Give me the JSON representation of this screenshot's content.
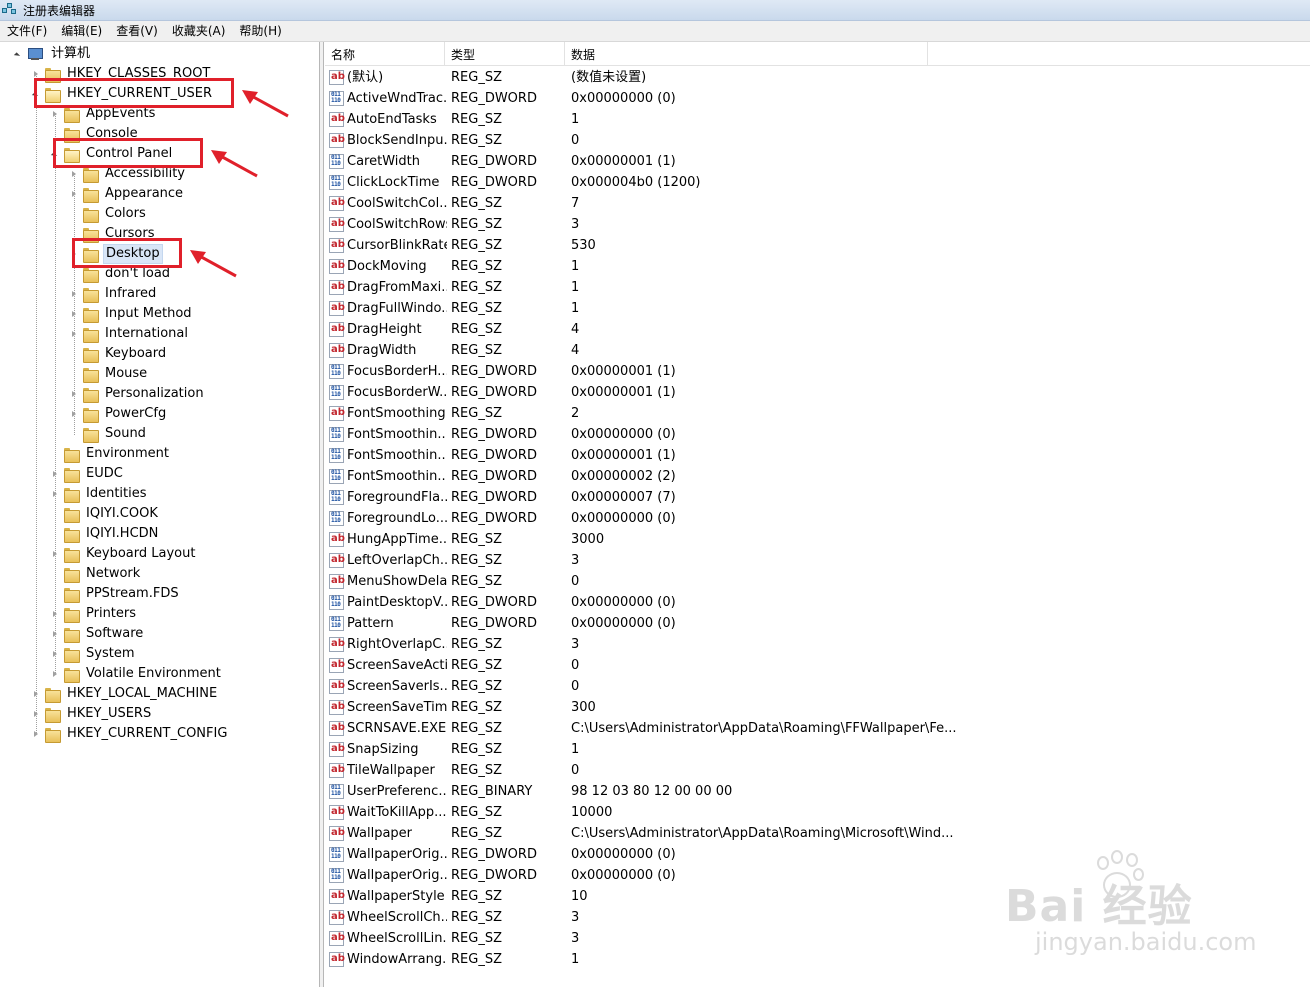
{
  "window": {
    "title": "注册表编辑器"
  },
  "menu": [
    "文件(F)",
    "编辑(E)",
    "查看(V)",
    "收藏夹(A)",
    "帮助(H)"
  ],
  "tree": [
    {
      "label": "计算机",
      "level": 0,
      "exp": "open",
      "icon": "computer-icon"
    },
    {
      "label": "HKEY_CLASSES_ROOT",
      "level": 1,
      "exp": "closed"
    },
    {
      "label": "HKEY_CURRENT_USER",
      "level": 1,
      "exp": "open",
      "highlight": true
    },
    {
      "label": "AppEvents",
      "level": 2,
      "exp": "closed"
    },
    {
      "label": "Console",
      "level": 2,
      "exp": "none"
    },
    {
      "label": "Control Panel",
      "level": 2,
      "exp": "open",
      "highlight": true
    },
    {
      "label": "Accessibility",
      "level": 3,
      "exp": "closed"
    },
    {
      "label": "Appearance",
      "level": 3,
      "exp": "closed"
    },
    {
      "label": "Colors",
      "level": 3,
      "exp": "none"
    },
    {
      "label": "Cursors",
      "level": 3,
      "exp": "none"
    },
    {
      "label": "Desktop",
      "level": 3,
      "exp": "closed",
      "highlight": true,
      "selected": true
    },
    {
      "label": "don't load",
      "level": 3,
      "exp": "none"
    },
    {
      "label": "Infrared",
      "level": 3,
      "exp": "closed"
    },
    {
      "label": "Input Method",
      "level": 3,
      "exp": "closed"
    },
    {
      "label": "International",
      "level": 3,
      "exp": "closed"
    },
    {
      "label": "Keyboard",
      "level": 3,
      "exp": "none"
    },
    {
      "label": "Mouse",
      "level": 3,
      "exp": "none"
    },
    {
      "label": "Personalization",
      "level": 3,
      "exp": "closed"
    },
    {
      "label": "PowerCfg",
      "level": 3,
      "exp": "closed"
    },
    {
      "label": "Sound",
      "level": 3,
      "exp": "none"
    },
    {
      "label": "Environment",
      "level": 2,
      "exp": "none"
    },
    {
      "label": "EUDC",
      "level": 2,
      "exp": "closed"
    },
    {
      "label": "Identities",
      "level": 2,
      "exp": "closed"
    },
    {
      "label": "IQIYI.COOK",
      "level": 2,
      "exp": "none"
    },
    {
      "label": "IQIYI.HCDN",
      "level": 2,
      "exp": "none"
    },
    {
      "label": "Keyboard Layout",
      "level": 2,
      "exp": "closed"
    },
    {
      "label": "Network",
      "level": 2,
      "exp": "none"
    },
    {
      "label": "PPStream.FDS",
      "level": 2,
      "exp": "none"
    },
    {
      "label": "Printers",
      "level": 2,
      "exp": "closed"
    },
    {
      "label": "Software",
      "level": 2,
      "exp": "closed"
    },
    {
      "label": "System",
      "level": 2,
      "exp": "closed"
    },
    {
      "label": "Volatile Environment",
      "level": 2,
      "exp": "closed"
    },
    {
      "label": "HKEY_LOCAL_MACHINE",
      "level": 1,
      "exp": "closed"
    },
    {
      "label": "HKEY_USERS",
      "level": 1,
      "exp": "closed"
    },
    {
      "label": "HKEY_CURRENT_CONFIG",
      "level": 1,
      "exp": "closed"
    }
  ],
  "columns": [
    "名称",
    "类型",
    "数据"
  ],
  "values": [
    {
      "name": "(默认)",
      "type": "REG_SZ",
      "data": "(数值未设置)",
      "icon": "string-value-icon"
    },
    {
      "name": "ActiveWndTrac...",
      "type": "REG_DWORD",
      "data": "0x00000000 (0)",
      "icon": "binary-value-icon"
    },
    {
      "name": "AutoEndTasks",
      "type": "REG_SZ",
      "data": "1",
      "icon": "string-value-icon"
    },
    {
      "name": "BlockSendInpu...",
      "type": "REG_SZ",
      "data": "0",
      "icon": "string-value-icon"
    },
    {
      "name": "CaretWidth",
      "type": "REG_DWORD",
      "data": "0x00000001 (1)",
      "icon": "binary-value-icon"
    },
    {
      "name": "ClickLockTime",
      "type": "REG_DWORD",
      "data": "0x000004b0 (1200)",
      "icon": "binary-value-icon"
    },
    {
      "name": "CoolSwitchCol...",
      "type": "REG_SZ",
      "data": "7",
      "icon": "string-value-icon"
    },
    {
      "name": "CoolSwitchRows",
      "type": "REG_SZ",
      "data": "3",
      "icon": "string-value-icon"
    },
    {
      "name": "CursorBlinkRate",
      "type": "REG_SZ",
      "data": "530",
      "icon": "string-value-icon"
    },
    {
      "name": "DockMoving",
      "type": "REG_SZ",
      "data": "1",
      "icon": "string-value-icon"
    },
    {
      "name": "DragFromMaxi...",
      "type": "REG_SZ",
      "data": "1",
      "icon": "string-value-icon"
    },
    {
      "name": "DragFullWindo...",
      "type": "REG_SZ",
      "data": "1",
      "icon": "string-value-icon"
    },
    {
      "name": "DragHeight",
      "type": "REG_SZ",
      "data": "4",
      "icon": "string-value-icon"
    },
    {
      "name": "DragWidth",
      "type": "REG_SZ",
      "data": "4",
      "icon": "string-value-icon"
    },
    {
      "name": "FocusBorderH...",
      "type": "REG_DWORD",
      "data": "0x00000001 (1)",
      "icon": "binary-value-icon"
    },
    {
      "name": "FocusBorderW...",
      "type": "REG_DWORD",
      "data": "0x00000001 (1)",
      "icon": "binary-value-icon"
    },
    {
      "name": "FontSmoothing",
      "type": "REG_SZ",
      "data": "2",
      "icon": "string-value-icon"
    },
    {
      "name": "FontSmoothin...",
      "type": "REG_DWORD",
      "data": "0x00000000 (0)",
      "icon": "binary-value-icon"
    },
    {
      "name": "FontSmoothin...",
      "type": "REG_DWORD",
      "data": "0x00000001 (1)",
      "icon": "binary-value-icon"
    },
    {
      "name": "FontSmoothin...",
      "type": "REG_DWORD",
      "data": "0x00000002 (2)",
      "icon": "binary-value-icon"
    },
    {
      "name": "ForegroundFla...",
      "type": "REG_DWORD",
      "data": "0x00000007 (7)",
      "icon": "binary-value-icon"
    },
    {
      "name": "ForegroundLo...",
      "type": "REG_DWORD",
      "data": "0x00000000 (0)",
      "icon": "binary-value-icon"
    },
    {
      "name": "HungAppTime...",
      "type": "REG_SZ",
      "data": "3000",
      "icon": "string-value-icon"
    },
    {
      "name": "LeftOverlapCh...",
      "type": "REG_SZ",
      "data": "3",
      "icon": "string-value-icon"
    },
    {
      "name": "MenuShowDelay",
      "type": "REG_SZ",
      "data": "0",
      "icon": "string-value-icon"
    },
    {
      "name": "PaintDesktopV...",
      "type": "REG_DWORD",
      "data": "0x00000000 (0)",
      "icon": "binary-value-icon"
    },
    {
      "name": "Pattern",
      "type": "REG_DWORD",
      "data": "0x00000000 (0)",
      "icon": "binary-value-icon"
    },
    {
      "name": "RightOverlapC...",
      "type": "REG_SZ",
      "data": "3",
      "icon": "string-value-icon"
    },
    {
      "name": "ScreenSaveActi...",
      "type": "REG_SZ",
      "data": "0",
      "icon": "string-value-icon"
    },
    {
      "name": "ScreenSaverIs...",
      "type": "REG_SZ",
      "data": "0",
      "icon": "string-value-icon"
    },
    {
      "name": "ScreenSaveTim...",
      "type": "REG_SZ",
      "data": "300",
      "icon": "string-value-icon"
    },
    {
      "name": "SCRNSAVE.EXE",
      "type": "REG_SZ",
      "data": "C:\\Users\\Administrator\\AppData\\Roaming\\FFWallpaper\\Fe...",
      "icon": "string-value-icon"
    },
    {
      "name": "SnapSizing",
      "type": "REG_SZ",
      "data": "1",
      "icon": "string-value-icon"
    },
    {
      "name": "TileWallpaper",
      "type": "REG_SZ",
      "data": "0",
      "icon": "string-value-icon"
    },
    {
      "name": "UserPreferenc...",
      "type": "REG_BINARY",
      "data": "98 12 03 80 12 00 00 00",
      "icon": "binary-value-icon"
    },
    {
      "name": "WaitToKillApp...",
      "type": "REG_SZ",
      "data": "10000",
      "icon": "string-value-icon"
    },
    {
      "name": "Wallpaper",
      "type": "REG_SZ",
      "data": "C:\\Users\\Administrator\\AppData\\Roaming\\Microsoft\\Wind...",
      "icon": "string-value-icon"
    },
    {
      "name": "WallpaperOrig...",
      "type": "REG_DWORD",
      "data": "0x00000000 (0)",
      "icon": "binary-value-icon"
    },
    {
      "name": "WallpaperOrig...",
      "type": "REG_DWORD",
      "data": "0x00000000 (0)",
      "icon": "binary-value-icon"
    },
    {
      "name": "WallpaperStyle",
      "type": "REG_SZ",
      "data": "10",
      "icon": "string-value-icon"
    },
    {
      "name": "WheelScrollCh...",
      "type": "REG_SZ",
      "data": "3",
      "icon": "string-value-icon"
    },
    {
      "name": "WheelScrollLin...",
      "type": "REG_SZ",
      "data": "3",
      "icon": "string-value-icon"
    },
    {
      "name": "WindowArrang...",
      "type": "REG_SZ",
      "data": "1",
      "icon": "string-value-icon"
    }
  ],
  "watermark": {
    "brand": "Bai 经验",
    "url": "jingyan.baidu.com"
  },
  "colors": {
    "annotation_red": "#e0202a",
    "selection": "#d9e6f7"
  }
}
